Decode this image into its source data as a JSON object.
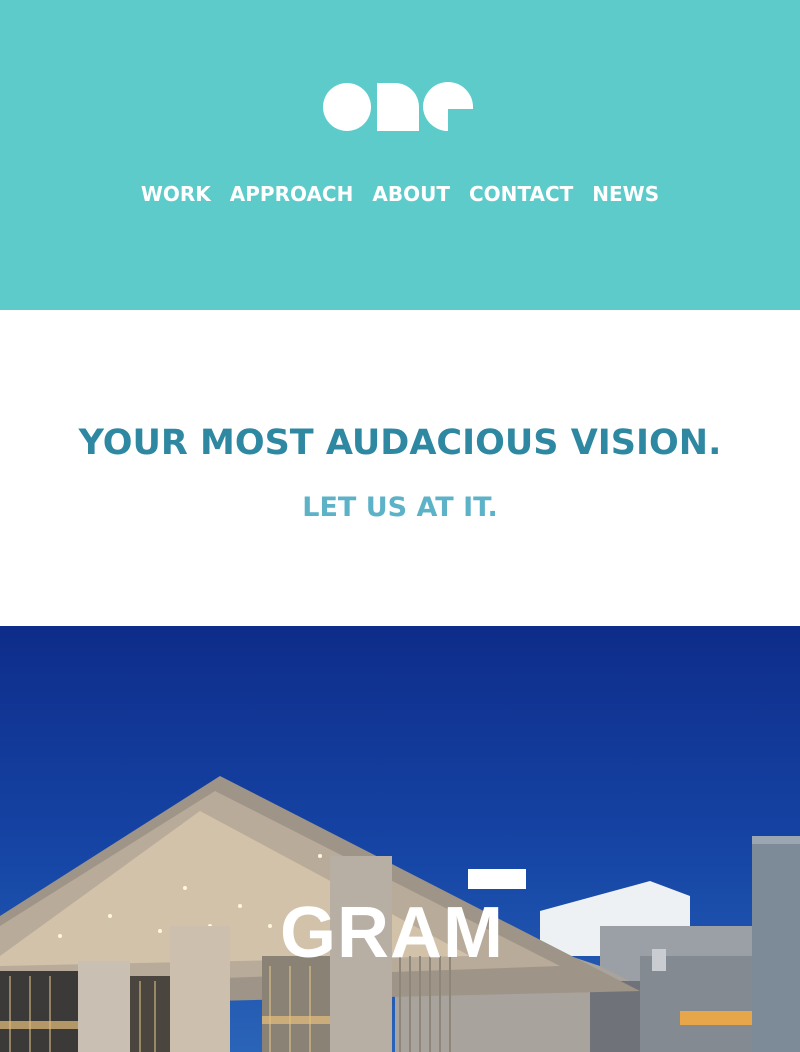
{
  "header": {
    "background": "#5ecbcb",
    "logo_text": "one",
    "nav": [
      {
        "label": "WORK"
      },
      {
        "label": "APPROACH"
      },
      {
        "label": "ABOUT"
      },
      {
        "label": "CONTACT"
      },
      {
        "label": "NEWS"
      }
    ]
  },
  "hero": {
    "headline": "YOUR MOST AUDACIOUS VISION.",
    "subline": "LET US AT IT.",
    "headline_color": "#2f88a1",
    "subline_color": "#5cb3c8"
  },
  "feature": {
    "image": "museum-building-at-dusk",
    "brand_text": "GRAM"
  }
}
